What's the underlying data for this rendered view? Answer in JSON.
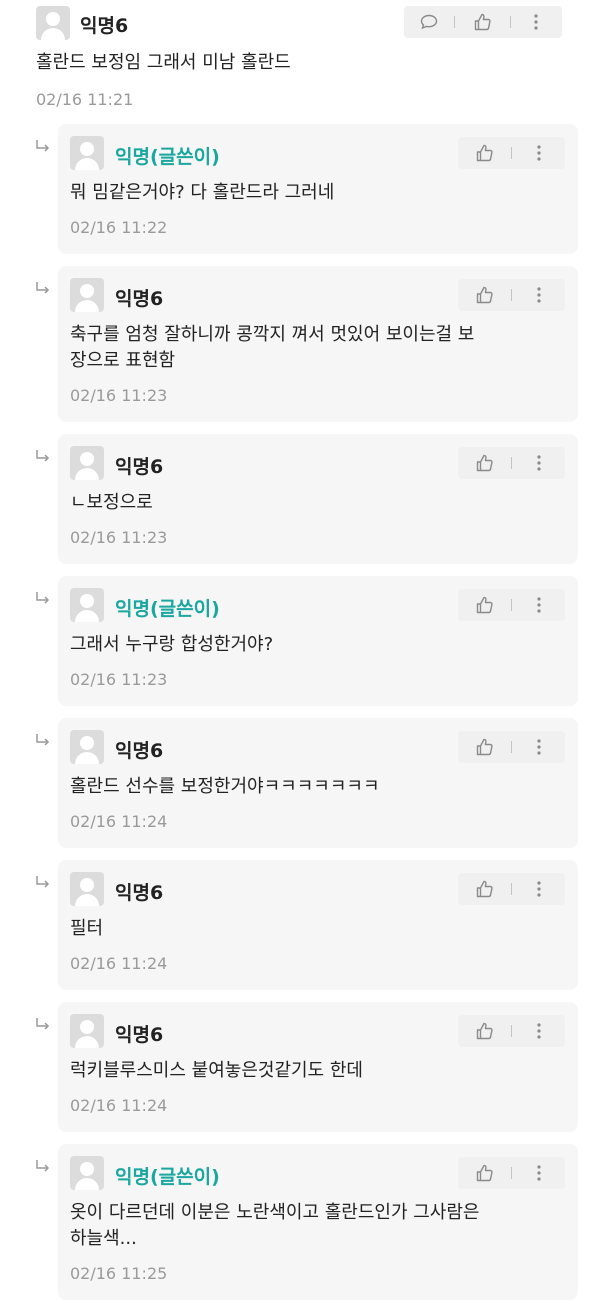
{
  "main_comment": {
    "author": "익명6",
    "text": "홀란드 보정임 그래서 미남 홀란드",
    "time": "02/16 11:21"
  },
  "replies": [
    {
      "author": "익명(글쓴이)",
      "is_op": true,
      "text": "뭐 밈같은거야? 다 홀란드라 그러네",
      "time": "02/16 11:22"
    },
    {
      "author": "익명6",
      "is_op": false,
      "text": "축구를 엄청 잘하니까 콩깍지 껴서 멋있어 보이는걸 보\n장으로 표현함",
      "time": "02/16 11:23"
    },
    {
      "author": "익명6",
      "is_op": false,
      "text": "ㄴ보정으로",
      "time": "02/16 11:23"
    },
    {
      "author": "익명(글쓴이)",
      "is_op": true,
      "text": "그래서 누구랑 합성한거야?",
      "time": "02/16 11:23"
    },
    {
      "author": "익명6",
      "is_op": false,
      "text": "홀란드 선수를 보정한거야ㅋㅋㅋㅋㅋㅋㅋ",
      "time": "02/16 11:24"
    },
    {
      "author": "익명6",
      "is_op": false,
      "text": "필터",
      "time": "02/16 11:24"
    },
    {
      "author": "익명6",
      "is_op": false,
      "text": "럭키블루스미스 붙여놓은것같기도 한데",
      "time": "02/16 11:24"
    },
    {
      "author": "익명(글쓴이)",
      "is_op": true,
      "text": "옷이 다르던데 이분은 노란색이고 홀란드인가 그사람은\n하늘색...",
      "time": "02/16 11:25"
    }
  ],
  "colors": {
    "author_accent": "#1aa7a0",
    "card_bg": "#f6f6f6",
    "action_bg": "#f0f0f0",
    "time": "#9a9a9a"
  },
  "icons": {
    "comment": "speech-bubble-icon",
    "like": "thumbs-up-icon",
    "more": "vertical-dots-icon",
    "reply": "reply-arrow-icon",
    "avatar": "default-avatar-icon"
  }
}
